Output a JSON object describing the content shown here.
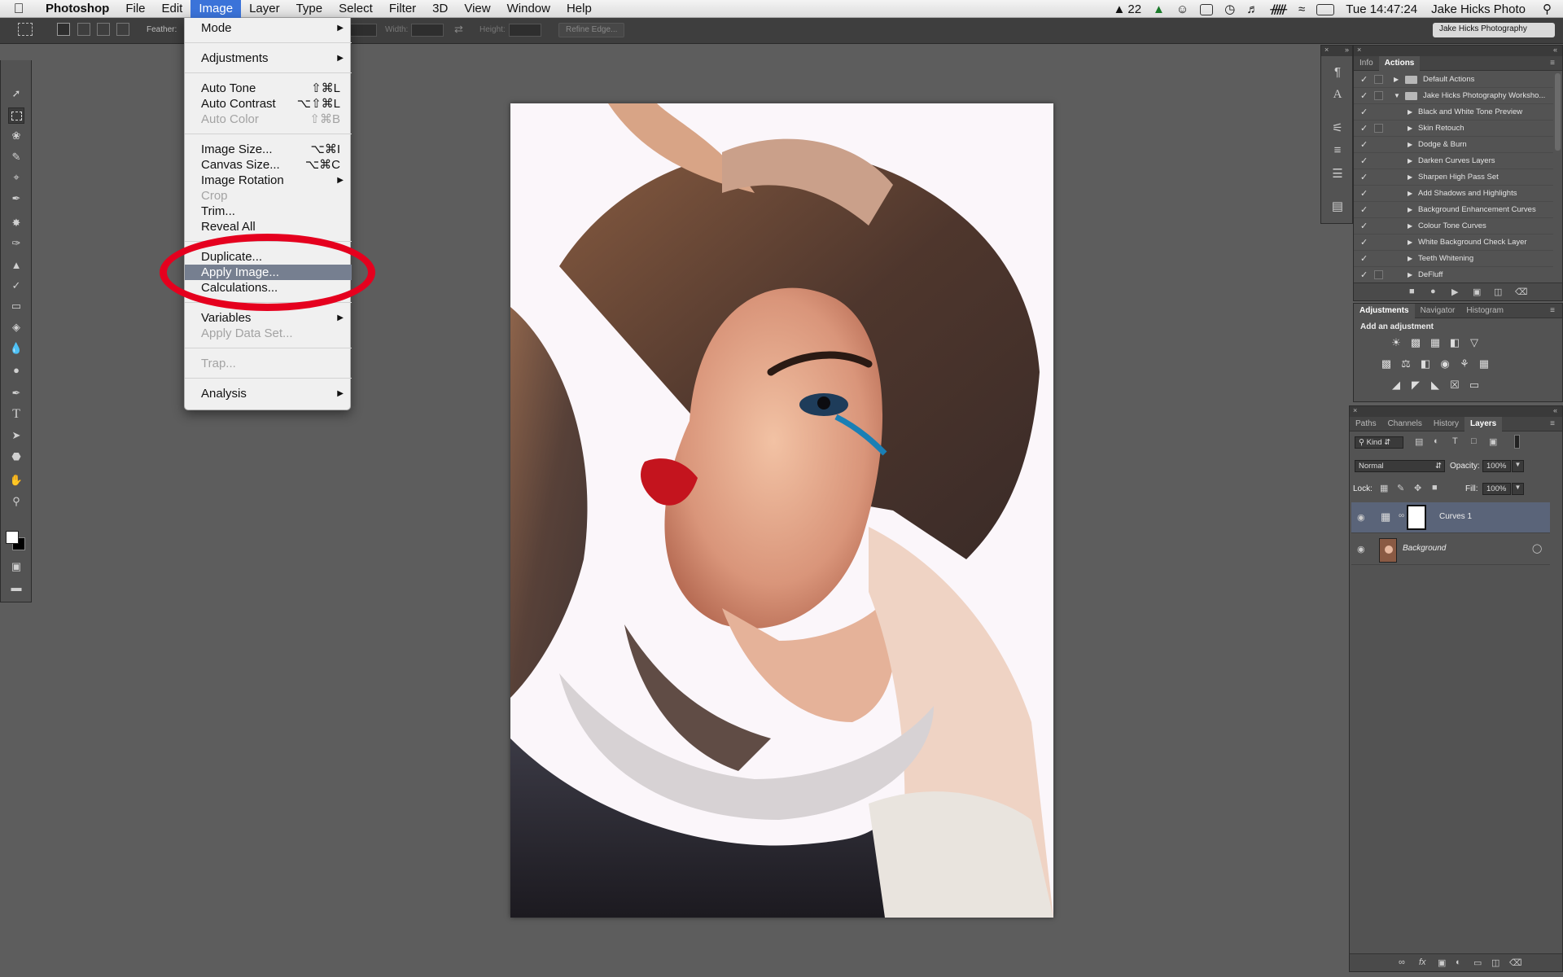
{
  "menubar": {
    "app_name": "Photoshop",
    "items": [
      "File",
      "Edit",
      "Image",
      "Layer",
      "Type",
      "Select",
      "Filter",
      "3D",
      "View",
      "Window",
      "Help"
    ],
    "active_item": "Image",
    "status": {
      "adobe_count": "22",
      "datetime": "Tue 14:47:24",
      "user": "Jake Hicks Photo"
    }
  },
  "options_bar": {
    "feather_label": "Feather:",
    "width_label": "Width:",
    "height_label": "Height:",
    "refine_edge_label": "Refine Edge...",
    "workspace": "Jake Hicks Photography"
  },
  "image_menu": {
    "items": [
      {
        "label": "Mode",
        "submenu": true
      },
      {
        "label": "Adjustments",
        "submenu": true
      },
      {
        "label": "Auto Tone",
        "shortcut": "⇧⌘L"
      },
      {
        "label": "Auto Contrast",
        "shortcut": "⌥⇧⌘L"
      },
      {
        "label": "Auto Color",
        "shortcut": "⇧⌘B",
        "disabled": true
      },
      {
        "label": "Image Size...",
        "shortcut": "⌥⌘I"
      },
      {
        "label": "Canvas Size...",
        "shortcut": "⌥⌘C"
      },
      {
        "label": "Image Rotation",
        "submenu": true
      },
      {
        "label": "Crop",
        "disabled": true
      },
      {
        "label": "Trim..."
      },
      {
        "label": "Reveal All"
      },
      {
        "label": "Duplicate..."
      },
      {
        "label": "Apply Image...",
        "highlighted": true
      },
      {
        "label": "Calculations..."
      },
      {
        "label": "Variables",
        "submenu": true
      },
      {
        "label": "Apply Data Set...",
        "disabled": true
      },
      {
        "label": "Trap...",
        "disabled": true
      },
      {
        "label": "Analysis",
        "submenu": true
      }
    ]
  },
  "actions_panel": {
    "tabs": [
      "Info",
      "Actions"
    ],
    "active_tab": "Actions",
    "sets": [
      {
        "name": "Default Actions",
        "expanded": false
      },
      {
        "name": "Jake Hicks Photography Worksho...",
        "expanded": true
      }
    ],
    "actions": [
      "Black and White Tone Preview",
      "Skin Retouch",
      "Dodge & Burn",
      "Darken Curves Layers",
      "Sharpen High Pass Set",
      "Add Shadows and Highlights",
      "Background Enhancement Curves",
      "Colour Tone Curves",
      "White Background Check Layer",
      "Teeth Whitening",
      "DeFluff"
    ]
  },
  "adjustments_panel": {
    "tabs": [
      "Adjustments",
      "Navigator",
      "Histogram"
    ],
    "active_tab": "Adjustments",
    "heading": "Add an adjustment"
  },
  "layers_panel": {
    "tabs": [
      "Paths",
      "Channels",
      "History",
      "Layers"
    ],
    "active_tab": "Layers",
    "filter": "Kind",
    "blend_mode": "Normal",
    "opacity_label": "Opacity:",
    "opacity": "100%",
    "lock_label": "Lock:",
    "fill_label": "Fill:",
    "fill": "100%",
    "layers": [
      {
        "name": "Curves 1",
        "selected": true
      },
      {
        "name": "Background",
        "locked": true
      }
    ]
  },
  "colors": {
    "menu_highlight": "#3b73d9",
    "item_highlight": "#767f90",
    "annotation_ring": "#e5001e"
  }
}
